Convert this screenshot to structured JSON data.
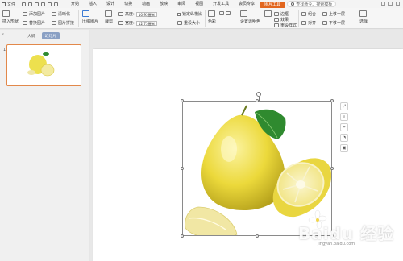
{
  "title_bar": {
    "file_menu": "文件",
    "tabs": [
      {
        "label": "开始",
        "active": false
      },
      {
        "label": "插入",
        "active": false
      },
      {
        "label": "设计",
        "active": false
      },
      {
        "label": "切换",
        "active": false
      },
      {
        "label": "动画",
        "active": false
      },
      {
        "label": "放映",
        "active": false
      },
      {
        "label": "审阅",
        "active": false
      },
      {
        "label": "视图",
        "active": false
      },
      {
        "label": "开发工具",
        "active": false
      },
      {
        "label": "会员专享",
        "active": false
      },
      {
        "label": "图片工具",
        "active": true
      }
    ],
    "search_placeholder": "查找命令、搜索模板"
  },
  "ribbon": {
    "insert_shape": "插入形状",
    "add_image": "添加图片",
    "replace_image": "替换图片",
    "compress_image": "压缩图片",
    "clarity": "清晰化",
    "image_split": "图片拼接",
    "crop": "裁剪",
    "height_label": "高度:",
    "height_value": "10.95厘米",
    "width_label": "宽度:",
    "width_value": "12.75厘米",
    "lock_ratio": "锁定纵横比",
    "reset_size": "重设大小",
    "color": "色彩",
    "set_transparent": "设置透明色",
    "outline": "边框",
    "effects": "效果",
    "reset_style": "重设样式",
    "combine": "组合",
    "align": "对齐",
    "move_up": "上移一层",
    "move_down": "下移一层",
    "select": "选择"
  },
  "left_panel": {
    "tab_outline": "大纲",
    "tab_slides": "幻灯片",
    "slide_number": "1"
  },
  "watermark": {
    "text": "Baidu 经验",
    "url": "jingyan.baidu.com"
  },
  "colors": {
    "accent": "#e2661f",
    "selection": "#e2884a",
    "pomelo_yellow": "#f2e04a",
    "leaf_green": "#2f8a2f"
  }
}
